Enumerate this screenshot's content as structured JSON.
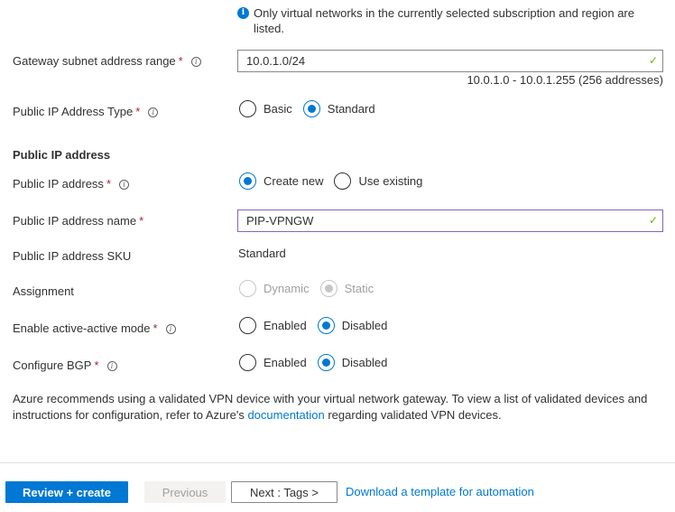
{
  "info_note": {
    "icon": "info-icon",
    "text": "Only virtual networks in the currently selected subscription and region are listed."
  },
  "gateway_subnet": {
    "label": "Gateway subnet address range",
    "required": "*",
    "value": "10.0.1.0/24",
    "valid_icon": "✓",
    "range_info": "10.0.1.0 - 10.0.1.255 (256 addresses)"
  },
  "public_ip_type": {
    "label": "Public IP Address Type",
    "required": "*",
    "options": [
      {
        "label": "Basic",
        "selected": false
      },
      {
        "label": "Standard",
        "selected": true
      }
    ]
  },
  "public_ip_section": {
    "title": "Public IP address"
  },
  "public_ip": {
    "label": "Public IP address",
    "required": "*",
    "options": [
      {
        "label": "Create new",
        "selected": true
      },
      {
        "label": "Use existing",
        "selected": false
      }
    ]
  },
  "public_ip_name": {
    "label": "Public IP address name",
    "required": "*",
    "value": "PIP-VPNGW",
    "valid_icon": "✓"
  },
  "public_ip_sku": {
    "label": "Public IP address SKU",
    "value": "Standard"
  },
  "assignment": {
    "label": "Assignment",
    "options": [
      {
        "label": "Dynamic",
        "selected": false,
        "disabled": true
      },
      {
        "label": "Static",
        "selected": true,
        "disabled": true
      }
    ]
  },
  "active_active": {
    "label": "Enable active-active mode",
    "required": "*",
    "options": [
      {
        "label": "Enabled",
        "selected": false
      },
      {
        "label": "Disabled",
        "selected": true
      }
    ]
  },
  "configure_bgp": {
    "label": "Configure BGP",
    "required": "*",
    "options": [
      {
        "label": "Enabled",
        "selected": false
      },
      {
        "label": "Disabled",
        "selected": true
      }
    ]
  },
  "recommendation": {
    "before_link": "Azure recommends using a validated VPN device with your virtual network gateway. To view a list of validated devices and instructions for configuration, refer to Azure's ",
    "link_text": "documentation",
    "after_link": " regarding validated VPN devices."
  },
  "footer": {
    "review_create": "Review + create",
    "previous": "Previous",
    "next": "Next : Tags >",
    "download_template": "Download a template for automation"
  },
  "colors": {
    "accent": "#0078d4",
    "valid": "#6bb700",
    "required": "#a4262c"
  }
}
